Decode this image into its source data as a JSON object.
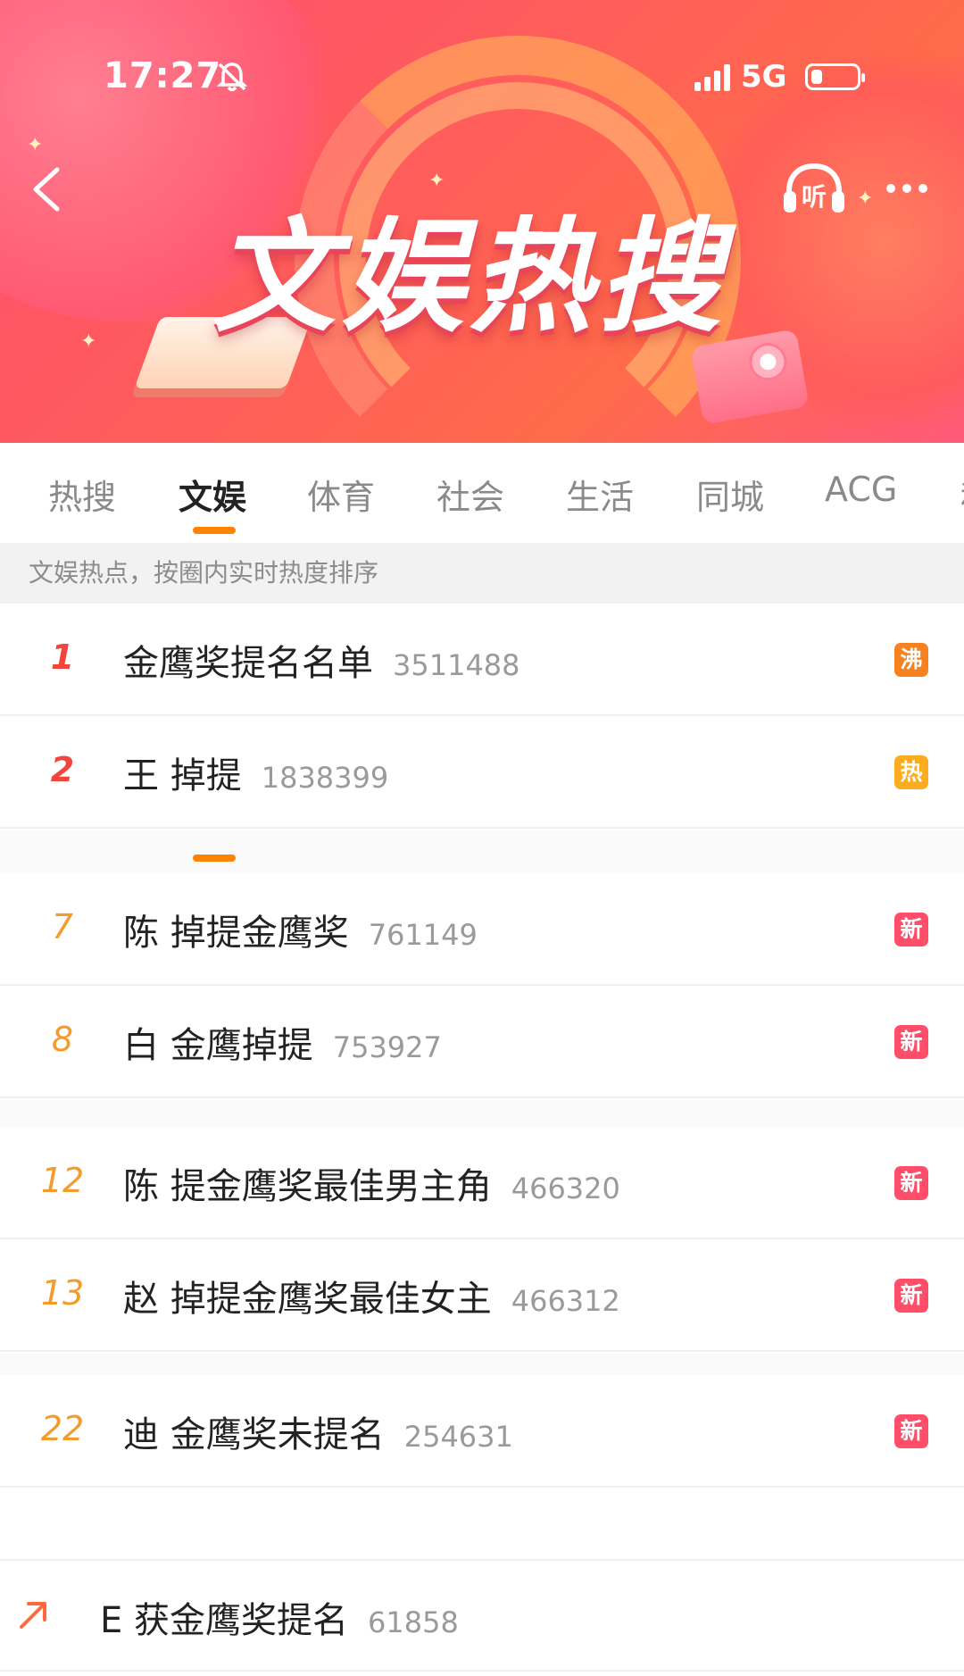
{
  "status_bar": {
    "time": "17:27",
    "network": "5G"
  },
  "header": {
    "banner_title": "文娱热搜",
    "listen_label": "听"
  },
  "tabs": [
    {
      "label": "热搜",
      "active": false
    },
    {
      "label": "文娱",
      "active": true
    },
    {
      "label": "体育",
      "active": false
    },
    {
      "label": "社会",
      "active": false
    },
    {
      "label": "生活",
      "active": false
    },
    {
      "label": "同城",
      "active": false
    },
    {
      "label": "ACG",
      "active": false
    },
    {
      "label": "科",
      "active": false
    }
  ],
  "subheader": "文娱热点，按圈内实时热度排序",
  "list": [
    {
      "rank": "1",
      "title": "金鹰奖提名名单",
      "count": "3511488",
      "badge": "沸",
      "badge_color": "#f5821f"
    },
    {
      "rank": "2",
      "title": "王 掉提",
      "count": "1838399",
      "badge": "热",
      "badge_color": "#fcad1f"
    },
    {
      "rank": "7",
      "title": "陈 掉提金鹰奖",
      "count": "761149",
      "badge": "新",
      "badge_color": "#ff4d6a"
    },
    {
      "rank": "8",
      "title": "白 金鹰掉提",
      "count": "753927",
      "badge": "新",
      "badge_color": "#ff4d6a"
    },
    {
      "rank": "12",
      "title": "陈 提金鹰奖最佳男主角",
      "count": "466320",
      "badge": "新",
      "badge_color": "#ff4d6a"
    },
    {
      "rank": "13",
      "title": "赵 掉提金鹰奖最佳女主",
      "count": "466312",
      "badge": "新",
      "badge_color": "#ff4d6a"
    },
    {
      "rank": "22",
      "title": "迪 金鹰奖未提名",
      "count": "254631",
      "badge": "新",
      "badge_color": "#ff4d6a"
    }
  ],
  "trending_row": {
    "title": "E 获金鹰奖提名",
    "count": "61858"
  },
  "colors": {
    "accent": "#ff8200",
    "top_rank": "#f2463c",
    "mid_rank": "#f39b2c"
  }
}
